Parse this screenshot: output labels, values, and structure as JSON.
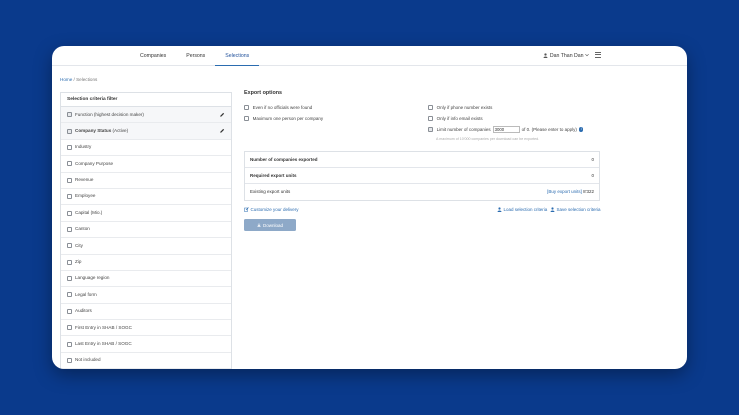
{
  "nav": {
    "items": [
      "Companies",
      "Persons",
      "Selections"
    ],
    "active": "Selections",
    "user": "Dan Than Dan"
  },
  "breadcrumb": {
    "home": "Home",
    "sep": "/",
    "current": "Selections"
  },
  "filter": {
    "title": "Selection criteria filter",
    "items": [
      {
        "label": "Function (highest decision maker)",
        "checked": true,
        "editable": true
      },
      {
        "label_bold": "Company Status",
        "label_rest": " (Active)",
        "checked": true,
        "editable": true
      },
      {
        "label": "Industry"
      },
      {
        "label": "Company Purpose"
      },
      {
        "label": "Revenue"
      },
      {
        "label": "Employee"
      },
      {
        "label": "Capital (Mio.)"
      },
      {
        "label": "Canton"
      },
      {
        "label": "City"
      },
      {
        "label": "Zip"
      },
      {
        "label": "Language region"
      },
      {
        "label": "Legal form"
      },
      {
        "label": "Auditors"
      },
      {
        "label": "First Entry in SHAB / SOGC"
      },
      {
        "label": "Last Entry in SHAB / SOGC"
      },
      {
        "label": "Not included"
      }
    ]
  },
  "export": {
    "title": "Export options",
    "options_left": [
      "Even if no officials were found",
      "Maximum one person per company"
    ],
    "options_right": [
      "Only if phone number exists",
      "Only if info email exists"
    ],
    "limit": {
      "label": "Limit number of companies",
      "value": "3000",
      "of": "of 0. (Please enter to apply)",
      "hint": "A maximum of 10'000 companies per download can be exported."
    },
    "summary": [
      {
        "label": "Number of companies exported",
        "value": "0",
        "bold": true
      },
      {
        "label": "Required export units",
        "value": "0",
        "bold": true
      },
      {
        "label": "Existing export units",
        "buy": "[Buy export units]",
        "value": "8'322",
        "bold": false
      }
    ],
    "customize": "Customize your delivery",
    "load": "Load selection criteria",
    "save": "Save selection criteria",
    "download": "Download"
  },
  "colors": {
    "background": "#0a3a8c",
    "accent": "#2b6cb0",
    "button": "#8ea9c8"
  }
}
